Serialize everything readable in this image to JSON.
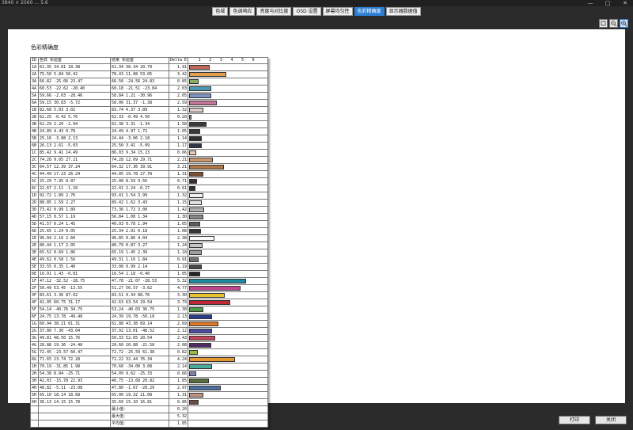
{
  "window": {
    "title": "3840 × 2060 … 5.6",
    "minimize": "—",
    "maximize": "□",
    "close": "✕"
  },
  "tabs": [
    "色域",
    "色调响应",
    "亮度与对比度",
    "OSD 设置",
    "屏幕均匀性",
    "色彩精确度",
    "显示器数据值"
  ],
  "active_tab": 5,
  "toolbar": {
    "icons": [
      "zoom-fit-icon",
      "zoom-out-icon",
      "zoom-in-icon"
    ]
  },
  "report": {
    "title": "色彩精确度",
    "header": {
      "id": "ID",
      "ref": "色样 实验室",
      "meas": "结果 实验室",
      "de": "Delta E",
      "scale": [
        "1",
        "2",
        "3",
        "4",
        "5",
        "6"
      ]
    },
    "rows": [
      {
        "id": "1A",
        "ref": "61.35  34.81  18.38",
        "meas": "61.34  38.34  20.79",
        "de": "1.91",
        "color": "#c0675a",
        "v": 1.91
      },
      {
        "id": "2A",
        "ref": "75.50   5.84  50.42",
        "meas": "78.43  11.08  53.05",
        "de": "3.42",
        "color": "#e0a050",
        "v": 3.42
      },
      {
        "id": "3A",
        "ref": "66.82 -25.06  23.47",
        "meas": "66.50 -24.56  24.83",
        "de": "0.85",
        "color": "#88b060",
        "v": 0.85
      },
      {
        "id": "4A",
        "ref": "60.53 -22.62 -20.40",
        "meas": "60.18 -21.51 -23.84",
        "de": "2.03",
        "color": "#4a98b4",
        "v": 2.03
      },
      {
        "id": "5A",
        "ref": "59.66  -2.03 -28.46",
        "meas": "58.84   1.21 -30.96",
        "de": "2.05",
        "color": "#7c94c4",
        "v": 2.05
      },
      {
        "id": "6A",
        "ref": "59.15  30.83  -5.72",
        "meas": "58.06  31.37  -1.38",
        "de": "2.59",
        "color": "#c47896",
        "v": 2.59
      },
      {
        "id": "1B",
        "ref": "82.68   5.03   3.02",
        "meas": "83.74   4.37   3.89",
        "de": "1.32",
        "color": "#ddcfcc",
        "v": 1.32
      },
      {
        "id": "2B",
        "ref": "62.25  -0.42   5.76",
        "meas": "62.33  -0.49   4.50",
        "de": "0.20",
        "color": "#9b9b94",
        "v": 0.2
      },
      {
        "id": "3B",
        "ref": "62.29   2.20  -2.94",
        "meas": "62.38   3.31  -1.34",
        "de": "1.58",
        "color": "#3a3a3a",
        "v": 1.58
      },
      {
        "id": "4B",
        "ref": "24.89   4.43   0.78",
        "meas": "24.49   4.97   1.72",
        "de": "1.05",
        "color": "#3c3838",
        "v": 1.05
      },
      {
        "id": "5B",
        "ref": "25.16  -3.88   2.13",
        "meas": "24.44  -3.06   2.18",
        "de": "1.14",
        "color": "#2e332e",
        "v": 1.14
      },
      {
        "id": "6B",
        "ref": "26.13   2.61  -5.03",
        "meas": "25.50   3.41  -5.09",
        "de": "1.17",
        "color": "#323545",
        "v": 1.17
      },
      {
        "id": "1C",
        "ref": "85.42   9.41  14.49",
        "meas": "86.03   9.34  15.23",
        "de": "0.66",
        "color": "#e8ccb8",
        "v": 0.66
      },
      {
        "id": "2C",
        "ref": "74.28   9.05  27.21",
        "meas": "74.28  12.09  29.71",
        "de": "2.21",
        "color": "#c89870",
        "v": 2.21
      },
      {
        "id": "3C",
        "ref": "64.57  12.39  37.24",
        "meas": "64.32  17.36  39.91",
        "de": "3.21",
        "color": "#b07848",
        "v": 3.21
      },
      {
        "id": "4C",
        "ref": "44.49  17.23  26.24",
        "meas": "44.05  19.78  27.78",
        "de": "1.31",
        "color": "#7a5038",
        "v": 1.31
      },
      {
        "id": "5C",
        "ref": "25.29   7.95   8.87",
        "meas": "25.08   8.59   9.56",
        "de": "0.71",
        "color": "#3e2e28",
        "v": 0.71
      },
      {
        "id": "6C",
        "ref": "22.67   2.11  -1.10",
        "meas": "22.41   2.24  -0.27",
        "de": "0.61",
        "color": "#333030",
        "v": 0.61
      },
      {
        "id": "1D",
        "ref": "92.72   1.89   2.76",
        "meas": "93.41   1.54   3.99",
        "de": "1.32",
        "color": "#f2efec",
        "v": 1.32
      },
      {
        "id": "2D",
        "ref": "88.85   1.59   2.27",
        "meas": "89.42   1.62   3.43",
        "de": "1.15",
        "color": "#e3dfdc",
        "v": 1.15
      },
      {
        "id": "3D",
        "ref": "73.42   0.99   1.89",
        "meas": "73.36   1.72   3.00",
        "de": "1.42",
        "color": "#b5b2b0",
        "v": 1.42
      },
      {
        "id": "4D",
        "ref": "57.15   0.57   1.19",
        "meas": "56.84   1.08   1.34",
        "de": "1.30",
        "color": "#8a8886",
        "v": 1.3
      },
      {
        "id": "5D",
        "ref": "41.57   0.24   1.45",
        "meas": "40.93   0.78   1.94",
        "de": "1.05",
        "color": "#5e5c5b",
        "v": 1.05
      },
      {
        "id": "6D",
        "ref": "25.65   1.24   0.05",
        "meas": "25.34   2.01   0.18",
        "de": "1.08",
        "color": "#383636",
        "v": 1.08
      },
      {
        "id": "1E",
        "ref": "96.04   2.16   2.60",
        "meas": "96.85   0.86   4.04",
        "de": "2.38",
        "color": "#fafafa",
        "v": 2.38
      },
      {
        "id": "2E",
        "ref": "80.44   1.17   2.05",
        "meas": "80.79   0.87   3.27",
        "de": "1.24",
        "color": "#c8c6c4",
        "v": 1.24
      },
      {
        "id": "3E",
        "ref": "65.52   0.69   1.86",
        "meas": "65.19   1.45   2.39",
        "de": "1.18",
        "color": "#a09e9c",
        "v": 1.18
      },
      {
        "id": "4E",
        "ref": "49.62   0.58   1.56",
        "meas": "49.31   1.16   1.84",
        "de": "0.91",
        "color": "#757372",
        "v": 0.91
      },
      {
        "id": "5E",
        "ref": "33.55   0.35   1.40",
        "meas": "33.08   0.99   2.14",
        "de": "1.19",
        "color": "#4c4a49",
        "v": 1.19
      },
      {
        "id": "6E",
        "ref": "16.91   1.43  -0.81",
        "meas": "16.54   2.18  -0.40",
        "de": "1.05",
        "color": "#262626",
        "v": 1.05
      },
      {
        "id": "1F",
        "ref": "47.12 -32.52 -28.75",
        "meas": "47.78 -21.07 -28.53",
        "de": "5.32",
        "color": "#1e8aa0",
        "v": 5.32
      },
      {
        "id": "2F",
        "ref": "50.49  53.45 -13.55",
        "meas": "51.27  56.57  -3.62",
        "de": "4.77",
        "color": "#c04890",
        "v": 4.77
      },
      {
        "id": "3F",
        "ref": "83.61   3.36  87.02",
        "meas": "83.51   9.34  88.76",
        "de": "3.30",
        "color": "#e8c030",
        "v": 3.3
      },
      {
        "id": "4F",
        "ref": "41.05  60.75  31.17",
        "meas": "42.63  63.54  29.54",
        "de": "3.79",
        "color": "#c02838",
        "v": 3.79
      },
      {
        "id": "5F",
        "ref": "54.14 -40.76  34.75",
        "meas": "53.24 -40.03  36.75",
        "de": "1.30",
        "color": "#4c9c48",
        "v": 1.3
      },
      {
        "id": "6F",
        "ref": "24.75  13.78 -49.48",
        "meas": "24.39  19.78 -50.18",
        "de": "2.13",
        "color": "#2a3c8c",
        "v": 2.13
      },
      {
        "id": "1G",
        "ref": "60.94  38.21  61.31",
        "meas": "61.88  43.38  69.14",
        "de": "2.69",
        "color": "#e07a28",
        "v": 2.69
      },
      {
        "id": "2G",
        "ref": "37.80   7.30 -43.04",
        "meas": "37.92  13.01 -48.52",
        "de": "2.12",
        "color": "#4a4c9c",
        "v": 2.12
      },
      {
        "id": "3G",
        "ref": "49.81  48.50  15.76",
        "meas": "50.33  52.65  20.54",
        "de": "2.43",
        "color": "#c04858",
        "v": 2.43
      },
      {
        "id": "4G",
        "ref": "28.88  19.36 -24.48",
        "meas": "28.60  20.88 -21.58",
        "de": "2.08",
        "color": "#502c60",
        "v": 2.08
      },
      {
        "id": "5G",
        "ref": "72.45 -23.57  60.47",
        "meas": "72.72 -25.59  61.38",
        "de": "0.82",
        "color": "#98bc40",
        "v": 0.82
      },
      {
        "id": "6G",
        "ref": "71.65  23.74  72.28",
        "meas": "72.22  32.44  76.34",
        "de": "4.24",
        "color": "#e89830",
        "v": 4.24
      },
      {
        "id": "1H",
        "ref": "70.19 -31.85   1.98",
        "meas": "70.60 -34.00   3.08",
        "de": "2.14",
        "color": "#48ac9c",
        "v": 2.14
      },
      {
        "id": "2H",
        "ref": "54.38   8.84 -25.71",
        "meas": "54.09   9.62 -25.33",
        "de": "0.66",
        "color": "#7c84b4",
        "v": 0.66
      },
      {
        "id": "3H",
        "ref": "42.03 -15.78  22.93",
        "meas": "40.75 -13.68  20.82",
        "de": "1.85",
        "color": "#5a6e3c",
        "v": 1.85
      },
      {
        "id": "4H",
        "ref": "48.82  -5.11 -23.08",
        "meas": "47.80  -1.67 -28.29",
        "de": "2.97",
        "color": "#4c70a0",
        "v": 2.97
      },
      {
        "id": "5H",
        "ref": "65.10  18.14  18.68",
        "meas": "65.00  19.32  21.08",
        "de": "1.31",
        "color": "#c09484",
        "v": 1.31
      },
      {
        "id": "6H",
        "ref": "36.13  14.15  15.78",
        "meas": "35.69  15.10  16.81",
        "de": "0.86",
        "color": "#6c4c40",
        "v": 0.86
      }
    ],
    "summary": [
      {
        "label": "最小值：",
        "value": "0.20"
      },
      {
        "label": "最大值：",
        "value": "5.32"
      },
      {
        "label": "平均值：",
        "value": "1.85"
      }
    ]
  },
  "footer": {
    "print": "打印",
    "close": "关闭"
  }
}
